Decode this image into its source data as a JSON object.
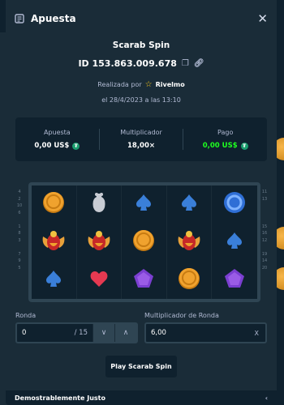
{
  "header": {
    "title": "Apuesta",
    "close_icon": "close-icon"
  },
  "game": {
    "name": "Scarab Spin",
    "bet_id": "ID 153.863.009.678"
  },
  "meta": {
    "made_by_prefix": "Realizada por",
    "user": "Rivelmo",
    "date": "el 28/4/2023 a las 13:10"
  },
  "stats": [
    {
      "label": "Apuesta",
      "value": "0,00 US$",
      "currency_icon": "tether-icon"
    },
    {
      "label": "Multiplicador",
      "value": "18,00×"
    },
    {
      "label": "Pago",
      "value": "0,00 US$",
      "currency_icon": "tether-icon",
      "color": "#1fff20"
    }
  ],
  "paylines": {
    "left": [
      "4",
      "2",
      "10",
      "6",
      "",
      "1",
      "8",
      "3",
      "",
      "7",
      "9",
      "5"
    ],
    "right": [
      "11",
      "13",
      "",
      "",
      "",
      "15",
      "16",
      "12",
      "",
      "19",
      "14",
      "20"
    ]
  },
  "reels": [
    [
      "coin",
      "scarab",
      "spade"
    ],
    [
      "vase",
      "scarab",
      "heart"
    ],
    [
      "spade",
      "coin",
      "pentagon"
    ],
    [
      "spade",
      "scarab",
      "coin"
    ],
    [
      "ring",
      "spade",
      "pentagon"
    ]
  ],
  "round": {
    "label": "Ronda",
    "value": "0",
    "total": "/ 15"
  },
  "round_multiplier": {
    "label": "Multiplicador de Ronda",
    "value": "6,00",
    "suffix": "X"
  },
  "play_button": "Play Scarab Spin",
  "footer": {
    "label": "Demostrablemente Justo"
  },
  "colors": {
    "background": "#0f212e",
    "panel": "#1a2c38",
    "border": "#2f4553",
    "green": "#1fff20"
  }
}
